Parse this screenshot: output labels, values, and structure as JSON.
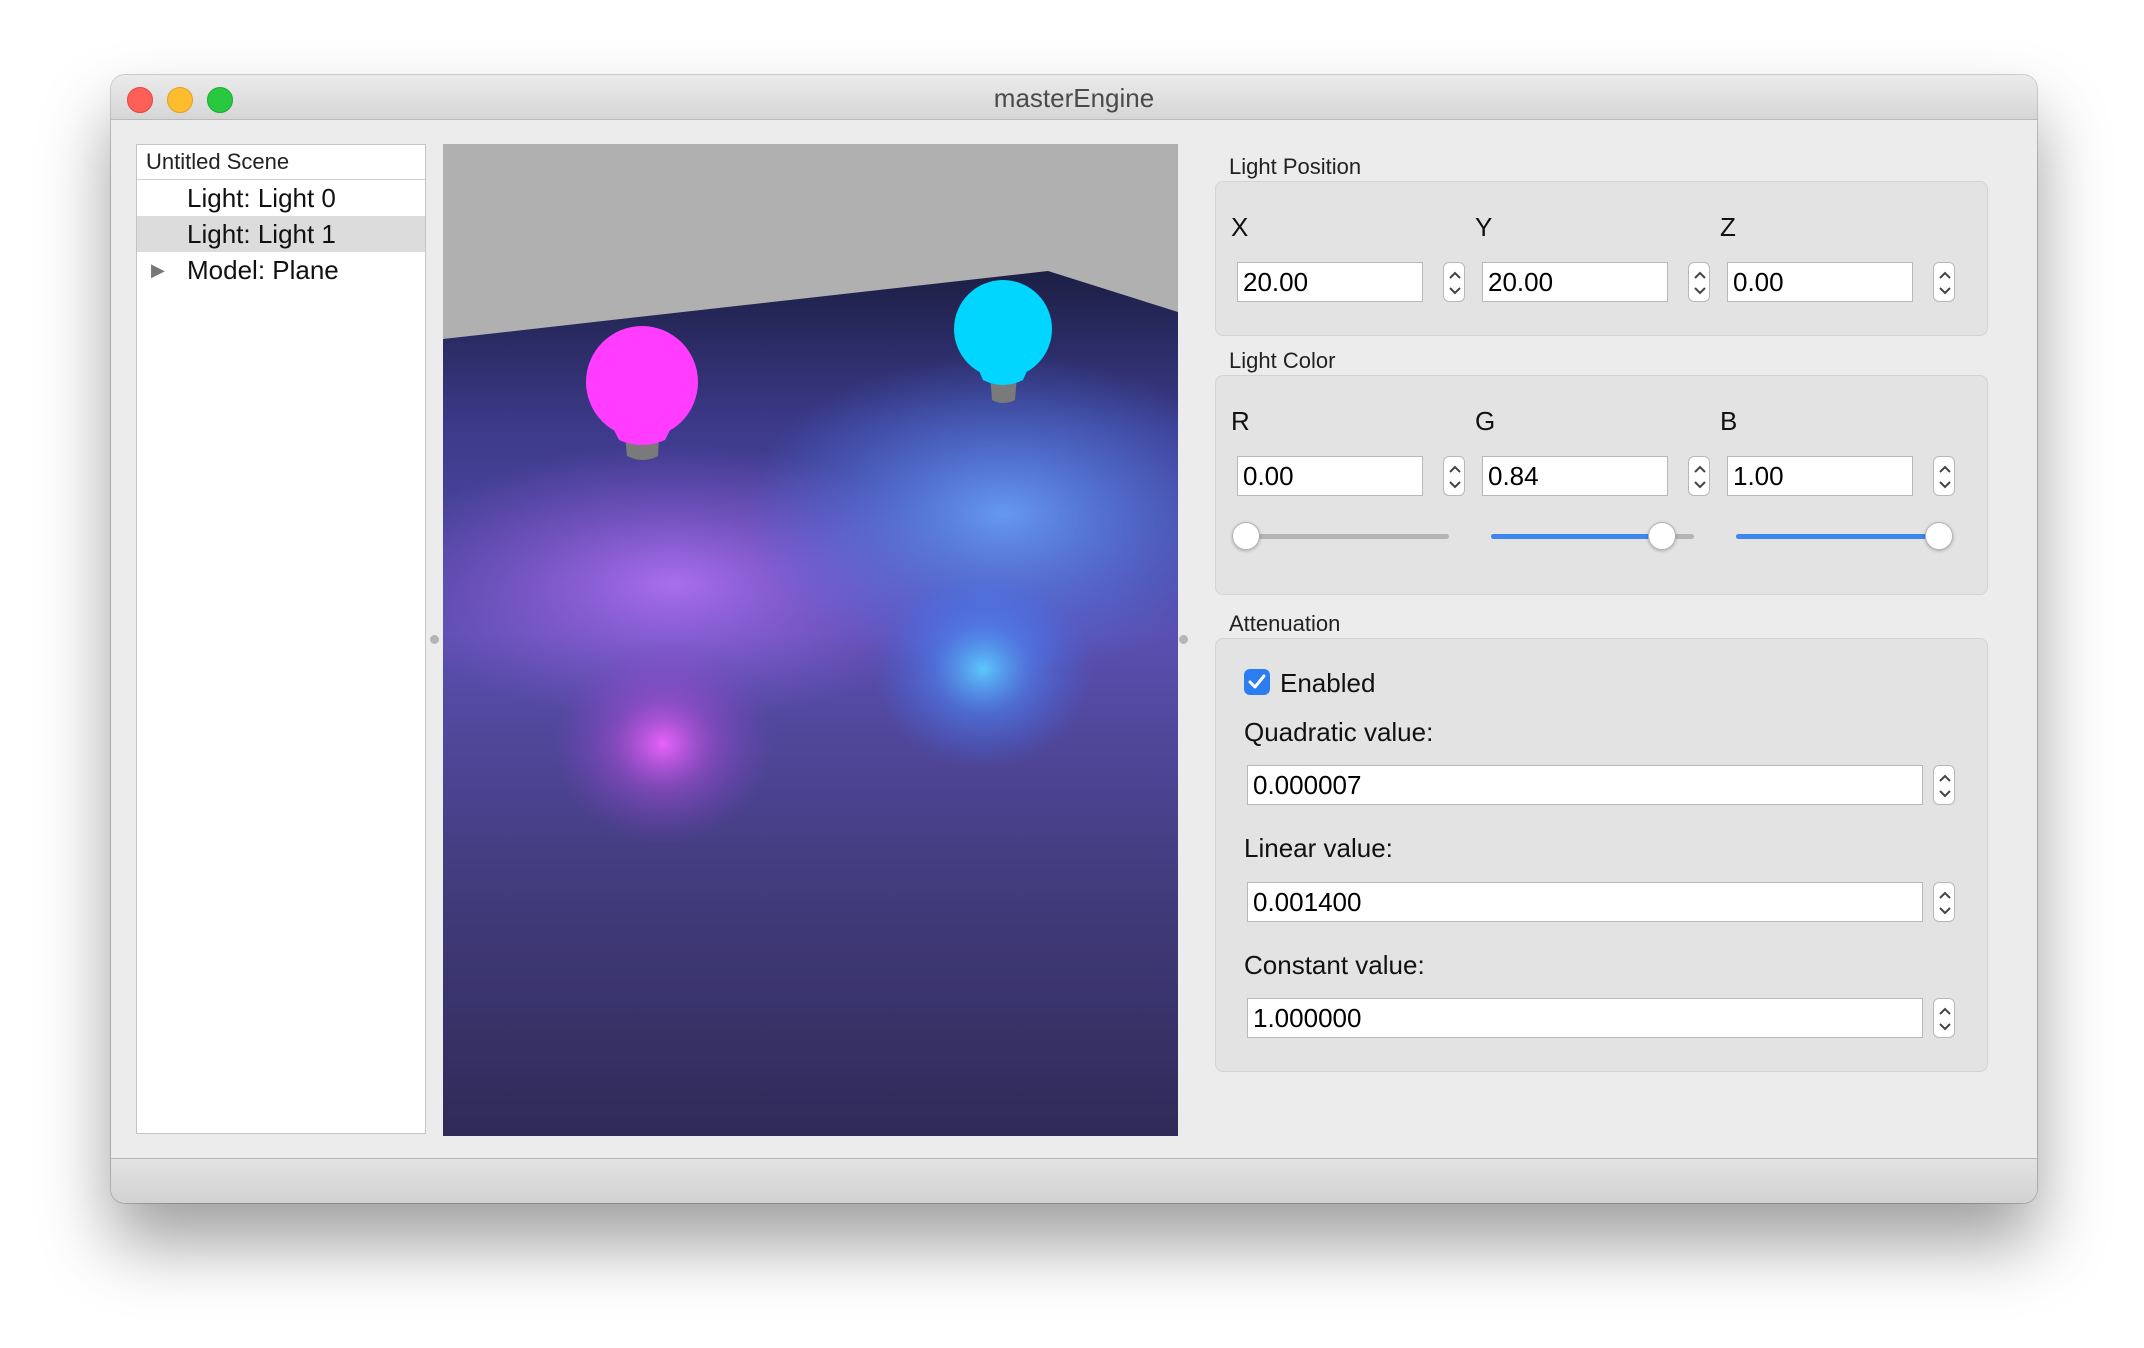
{
  "window": {
    "title": "masterEngine"
  },
  "scene_tree": {
    "header": "Untitled Scene",
    "items": [
      {
        "label": "Light: Light 0",
        "selected": false,
        "expandable": false
      },
      {
        "label": "Light: Light 1",
        "selected": true,
        "expandable": false
      },
      {
        "label": "Model: Plane",
        "selected": false,
        "expandable": true
      }
    ]
  },
  "viewport": {
    "lights": [
      {
        "name": "Light 0",
        "color": "#ff3cff"
      },
      {
        "name": "Light 1",
        "color": "#00d6ff"
      }
    ]
  },
  "light_position": {
    "title": "Light Position",
    "x_label": "X",
    "x_value": "20.00",
    "y_label": "Y",
    "y_value": "20.00",
    "z_label": "Z",
    "z_value": "0.00"
  },
  "light_color": {
    "title": "Light Color",
    "r_label": "R",
    "r_value": "0.00",
    "r_fraction": 0.0,
    "g_label": "G",
    "g_value": "0.84",
    "g_fraction": 0.84,
    "b_label": "B",
    "b_value": "1.00",
    "b_fraction": 1.0,
    "accent": "#3d86f0"
  },
  "attenuation": {
    "title": "Attenuation",
    "enabled_label": "Enabled",
    "enabled": true,
    "quadratic_label": "Quadratic value:",
    "quadratic_value": "0.000007",
    "linear_label": "Linear value:",
    "linear_value": "0.001400",
    "constant_label": "Constant value:",
    "constant_value": "1.000000"
  }
}
